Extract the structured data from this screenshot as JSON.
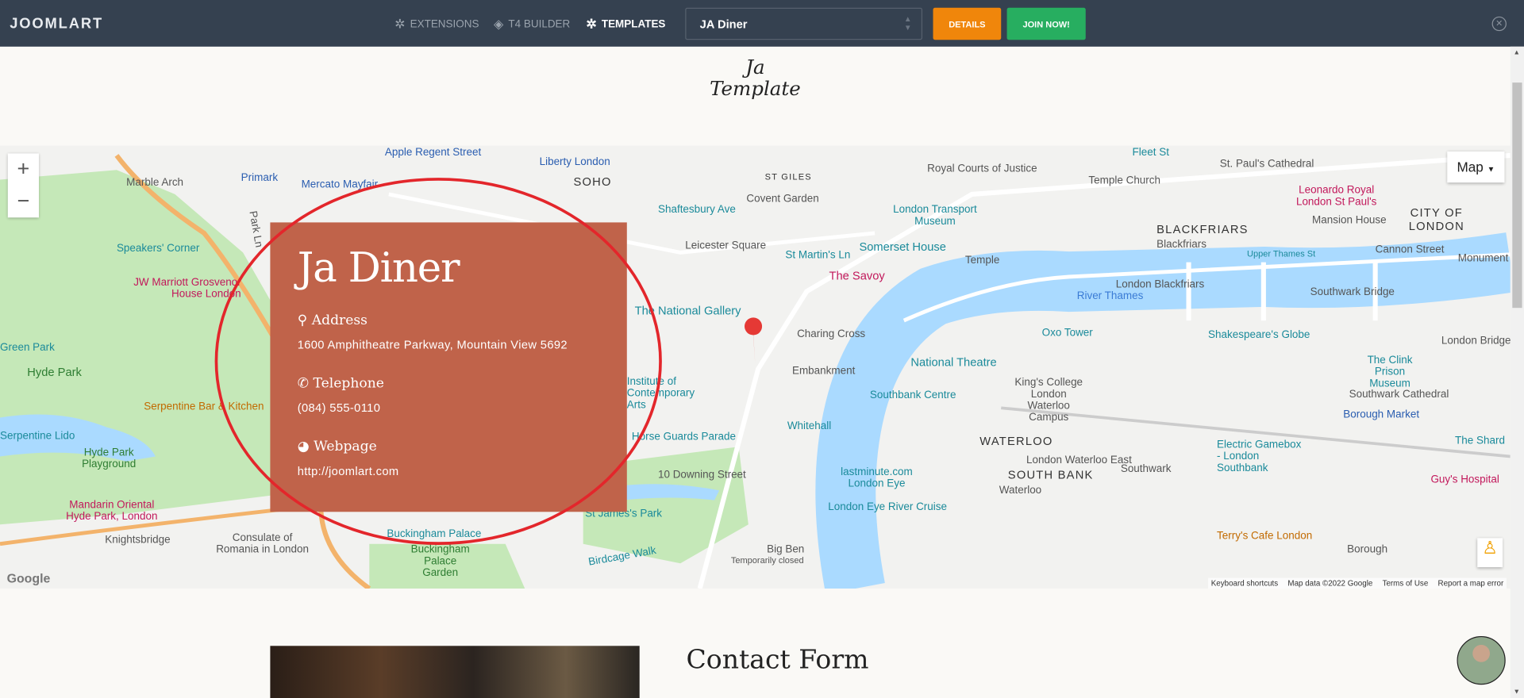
{
  "topbar": {
    "logo": "JOOMLART",
    "nav": [
      {
        "label": "EXTENSIONS",
        "icon": "joomla-icon"
      },
      {
        "label": "T4 BUILDER",
        "icon": "layers-icon"
      },
      {
        "label": "TEMPLATES",
        "icon": "joomla-icon"
      }
    ],
    "template_select": "JA Diner",
    "details": "DETAILS",
    "join": "JOIN NOW!",
    "colors": {
      "bar": "#354150",
      "details": "#f0860b",
      "join": "#27ae60"
    }
  },
  "brand_logo": "Ja Template",
  "map": {
    "type_control": "Map",
    "zoom_in": "+",
    "zoom_out": "−",
    "google": "Google",
    "attribution": [
      "Keyboard shortcuts",
      "Map data ©2022 Google",
      "Terms of Use",
      "Report a map error"
    ],
    "labels": [
      "Apple Regent Street",
      "Liberty London",
      "SOHO",
      "Primark",
      "Mercato Mayfair",
      "Marble Arch",
      "Speakers' Corner",
      "JW Marriott Grosvenor House London",
      "Hyde Park",
      "Serpentine Bar & Kitchen",
      "Serpentine Lido",
      "Hyde Park Playground",
      "Mandarin Oriental Hyde Park, London",
      "Knightsbridge",
      "Consulate of Romania in London",
      "Shaftesbury Ave",
      "Covent Garden",
      "Leicester Square",
      "St Martin's Ln",
      "The National Gallery",
      "The Savoy",
      "Somerset House",
      "London Transport Museum",
      "Royal Courts of Justice",
      "Fleet St",
      "Temple Church",
      "St. Paul's Cathedral",
      "Leonardo Royal London St Paul's",
      "CITY OF LONDON",
      "BLACKFRIARS",
      "Mansion House",
      "Cannon Street",
      "Monument",
      "London Blackfriars",
      "River Thames",
      "Southwark Bridge",
      "Oxo Tower",
      "Shakespeare's Globe",
      "London Bridge",
      "The Clink Prison Museum",
      "Southwark Cathedral",
      "Borough Market",
      "The Shard",
      "National Theatre",
      "Southbank Centre",
      "King's College London Waterloo Campus",
      "WATERLOO",
      "SOUTH BANK",
      "London Waterloo East",
      "Electric Gamebox - London Southbank",
      "Guy's Hospital",
      "Terry's Cafe London",
      "Whitehall",
      "Horse Guards Parade",
      "10 Downing Street",
      "St James's Park",
      "lastminute.com London Eye",
      "London Eye River Cruise",
      "Buckingham Palace",
      "Buckingham Palace Garden",
      "Birdcage Walk",
      "Big Ben",
      "Temporarily closed",
      "Embankment",
      "Charing Cross",
      "Institute of Contemporary Arts",
      "Temple",
      "Upper Thames St",
      "Blackfriars",
      "Southwark",
      "Waterloo",
      "Borough",
      "Green Park",
      "ST GILES",
      "Park Ln"
    ]
  },
  "card": {
    "title": "Ja Diner",
    "address_label": "Address",
    "address": "1600 Amphitheatre Parkway, Mountain View 5692",
    "phone_label": "Telephone",
    "phone": "(084) 555-0110",
    "web_label": "Webpage",
    "web": "http://joomlart.com",
    "color": "#c0634a"
  },
  "contact": {
    "title": "Contact Form"
  }
}
